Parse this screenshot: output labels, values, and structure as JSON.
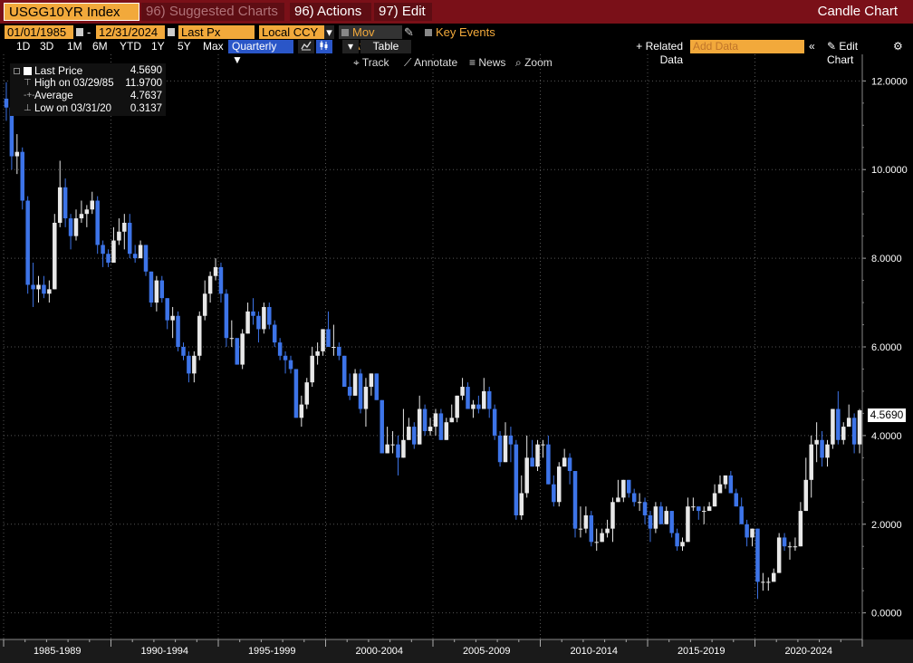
{
  "topbar": {
    "ticker": "USGG10YR Index",
    "suggested": "96) Suggested Charts ▾",
    "actions": "96) Actions ▾",
    "edit": "97) Edit ▾",
    "chart_type": "Candle Chart"
  },
  "controls": {
    "start_date": "01/01/1985",
    "end_date": "12/31/2024",
    "field": "Last Px",
    "currency": "Local CCY",
    "mov_avgs": "Mov Avgs",
    "key_events": "Key Events",
    "periods": [
      "1D",
      "3D",
      "1M",
      "6M",
      "YTD",
      "1Y",
      "5Y",
      "Max"
    ],
    "frequency": "Quarterly ▼",
    "table": "Table",
    "related_data": "+ Related Data",
    "add_data_placeholder": "Add Data",
    "edit_chart": "Edit Chart",
    "tools": {
      "track": "Track",
      "annotate": "Annotate",
      "news": "News",
      "zoom": "Zoom"
    }
  },
  "legend": {
    "last_label": "Last Price",
    "last_value": "4.5690",
    "high_label": "High on 03/29/85",
    "high_value": "11.9700",
    "avg_label": "Average",
    "avg_value": "4.7637",
    "low_label": "Low on 03/31/20",
    "low_value": "0.3137"
  },
  "last_price_tag": "4.5690",
  "colors": {
    "up": "#e8e8e8",
    "down": "#3d74e8",
    "grid": "#555555",
    "accent": "#f2a93b",
    "topbar": "#7a1018"
  },
  "chart_data": {
    "type": "candlestick",
    "frequency": "quarterly",
    "ylim": [
      -0.6,
      12.6
    ],
    "yticks": [
      "0.0000",
      "2.0000",
      "4.0000",
      "6.0000",
      "8.0000",
      "10.0000",
      "12.0000"
    ],
    "x_range": [
      1985.0,
      2025.0
    ],
    "x_categories": [
      "1985-1989",
      "1990-1994",
      "1995-1999",
      "2000-2004",
      "2005-2009",
      "2010-2014",
      "2015-2019",
      "2020-2024"
    ],
    "x_category_starts": [
      1985,
      1990,
      1995,
      2000,
      2005,
      2010,
      2015,
      2020
    ],
    "quarters": [
      {
        "t": "1985Q1",
        "o": 11.6,
        "h": 11.97,
        "l": 11.1,
        "c": 11.4
      },
      {
        "t": "1985Q2",
        "o": 11.4,
        "h": 11.5,
        "l": 10.0,
        "c": 10.3
      },
      {
        "t": "1985Q3",
        "o": 10.3,
        "h": 10.8,
        "l": 9.9,
        "c": 10.4
      },
      {
        "t": "1985Q4",
        "o": 10.4,
        "h": 10.5,
        "l": 9.1,
        "c": 9.3
      },
      {
        "t": "1986Q1",
        "o": 9.3,
        "h": 9.4,
        "l": 7.2,
        "c": 7.4
      },
      {
        "t": "1986Q2",
        "o": 7.4,
        "h": 7.9,
        "l": 6.9,
        "c": 7.3
      },
      {
        "t": "1986Q3",
        "o": 7.3,
        "h": 7.6,
        "l": 7.0,
        "c": 7.4
      },
      {
        "t": "1986Q4",
        "o": 7.4,
        "h": 7.6,
        "l": 7.1,
        "c": 7.2
      },
      {
        "t": "1987Q1",
        "o": 7.2,
        "h": 7.5,
        "l": 7.0,
        "c": 7.3
      },
      {
        "t": "1987Q2",
        "o": 7.3,
        "h": 9.0,
        "l": 7.3,
        "c": 8.8
      },
      {
        "t": "1987Q3",
        "o": 8.8,
        "h": 10.2,
        "l": 8.7,
        "c": 9.6
      },
      {
        "t": "1987Q4",
        "o": 9.6,
        "h": 9.8,
        "l": 8.7,
        "c": 8.9
      },
      {
        "t": "1988Q1",
        "o": 8.9,
        "h": 9.0,
        "l": 8.2,
        "c": 8.5
      },
      {
        "t": "1988Q2",
        "o": 8.5,
        "h": 9.1,
        "l": 8.4,
        "c": 8.9
      },
      {
        "t": "1988Q3",
        "o": 8.9,
        "h": 9.3,
        "l": 8.8,
        "c": 9.0
      },
      {
        "t": "1988Q4",
        "o": 9.0,
        "h": 9.2,
        "l": 8.7,
        "c": 9.1
      },
      {
        "t": "1989Q1",
        "o": 9.1,
        "h": 9.5,
        "l": 9.0,
        "c": 9.3
      },
      {
        "t": "1989Q2",
        "o": 9.3,
        "h": 9.4,
        "l": 8.1,
        "c": 8.3
      },
      {
        "t": "1989Q3",
        "o": 8.3,
        "h": 8.4,
        "l": 7.8,
        "c": 8.1
      },
      {
        "t": "1989Q4",
        "o": 8.1,
        "h": 8.2,
        "l": 7.8,
        "c": 7.9
      },
      {
        "t": "1990Q1",
        "o": 7.9,
        "h": 8.7,
        "l": 7.9,
        "c": 8.4
      },
      {
        "t": "1990Q2",
        "o": 8.4,
        "h": 8.9,
        "l": 8.3,
        "c": 8.6
      },
      {
        "t": "1990Q3",
        "o": 8.6,
        "h": 9.0,
        "l": 8.2,
        "c": 8.8
      },
      {
        "t": "1990Q4",
        "o": 8.8,
        "h": 9.0,
        "l": 8.0,
        "c": 8.1
      },
      {
        "t": "1991Q1",
        "o": 8.1,
        "h": 8.3,
        "l": 7.9,
        "c": 8.0
      },
      {
        "t": "1991Q2",
        "o": 8.0,
        "h": 8.4,
        "l": 8.0,
        "c": 8.3
      },
      {
        "t": "1991Q3",
        "o": 8.3,
        "h": 8.3,
        "l": 7.6,
        "c": 7.7
      },
      {
        "t": "1991Q4",
        "o": 7.7,
        "h": 7.7,
        "l": 6.9,
        "c": 7.0
      },
      {
        "t": "1992Q1",
        "o": 7.0,
        "h": 7.6,
        "l": 6.8,
        "c": 7.5
      },
      {
        "t": "1992Q2",
        "o": 7.5,
        "h": 7.6,
        "l": 7.0,
        "c": 7.1
      },
      {
        "t": "1992Q3",
        "o": 7.1,
        "h": 7.1,
        "l": 6.4,
        "c": 6.6
      },
      {
        "t": "1992Q4",
        "o": 6.6,
        "h": 6.9,
        "l": 6.2,
        "c": 6.7
      },
      {
        "t": "1993Q1",
        "o": 6.7,
        "h": 6.8,
        "l": 5.9,
        "c": 6.0
      },
      {
        "t": "1993Q2",
        "o": 6.0,
        "h": 6.1,
        "l": 5.7,
        "c": 5.8
      },
      {
        "t": "1993Q3",
        "o": 5.8,
        "h": 5.9,
        "l": 5.2,
        "c": 5.4
      },
      {
        "t": "1993Q4",
        "o": 5.4,
        "h": 5.9,
        "l": 5.2,
        "c": 5.8
      },
      {
        "t": "1994Q1",
        "o": 5.8,
        "h": 6.8,
        "l": 5.7,
        "c": 6.7
      },
      {
        "t": "1994Q2",
        "o": 6.7,
        "h": 7.5,
        "l": 6.6,
        "c": 7.2
      },
      {
        "t": "1994Q3",
        "o": 7.2,
        "h": 7.7,
        "l": 7.0,
        "c": 7.6
      },
      {
        "t": "1994Q4",
        "o": 7.6,
        "h": 8.0,
        "l": 7.5,
        "c": 7.8
      },
      {
        "t": "1995Q1",
        "o": 7.8,
        "h": 7.9,
        "l": 7.0,
        "c": 7.2
      },
      {
        "t": "1995Q2",
        "o": 7.2,
        "h": 7.3,
        "l": 6.0,
        "c": 6.2
      },
      {
        "t": "1995Q3",
        "o": 6.2,
        "h": 6.6,
        "l": 6.0,
        "c": 6.2
      },
      {
        "t": "1995Q4",
        "o": 6.2,
        "h": 6.2,
        "l": 5.6,
        "c": 5.6
      },
      {
        "t": "1996Q1",
        "o": 5.6,
        "h": 6.4,
        "l": 5.5,
        "c": 6.3
      },
      {
        "t": "1996Q2",
        "o": 6.3,
        "h": 7.0,
        "l": 6.3,
        "c": 6.8
      },
      {
        "t": "1996Q3",
        "o": 6.8,
        "h": 7.1,
        "l": 6.5,
        "c": 6.7
      },
      {
        "t": "1996Q4",
        "o": 6.7,
        "h": 6.8,
        "l": 6.1,
        "c": 6.4
      },
      {
        "t": "1997Q1",
        "o": 6.4,
        "h": 7.0,
        "l": 6.3,
        "c": 6.9
      },
      {
        "t": "1997Q2",
        "o": 6.9,
        "h": 7.0,
        "l": 6.4,
        "c": 6.5
      },
      {
        "t": "1997Q3",
        "o": 6.5,
        "h": 6.6,
        "l": 6.0,
        "c": 6.1
      },
      {
        "t": "1997Q4",
        "o": 6.1,
        "h": 6.2,
        "l": 5.7,
        "c": 5.8
      },
      {
        "t": "1998Q1",
        "o": 5.8,
        "h": 5.9,
        "l": 5.4,
        "c": 5.7
      },
      {
        "t": "1998Q2",
        "o": 5.7,
        "h": 5.8,
        "l": 5.4,
        "c": 5.5
      },
      {
        "t": "1998Q3",
        "o": 5.5,
        "h": 5.5,
        "l": 4.4,
        "c": 4.4
      },
      {
        "t": "1998Q4",
        "o": 4.4,
        "h": 4.9,
        "l": 4.2,
        "c": 4.7
      },
      {
        "t": "1999Q1",
        "o": 4.7,
        "h": 5.3,
        "l": 4.6,
        "c": 5.2
      },
      {
        "t": "1999Q2",
        "o": 5.2,
        "h": 6.0,
        "l": 5.1,
        "c": 5.8
      },
      {
        "t": "1999Q3",
        "o": 5.8,
        "h": 6.1,
        "l": 5.6,
        "c": 5.9
      },
      {
        "t": "1999Q4",
        "o": 5.9,
        "h": 6.4,
        "l": 5.8,
        "c": 6.4
      },
      {
        "t": "2000Q1",
        "o": 6.4,
        "h": 6.8,
        "l": 6.0,
        "c": 6.0
      },
      {
        "t": "2000Q2",
        "o": 6.0,
        "h": 6.5,
        "l": 5.8,
        "c": 6.0
      },
      {
        "t": "2000Q3",
        "o": 6.0,
        "h": 6.1,
        "l": 5.7,
        "c": 5.8
      },
      {
        "t": "2000Q4",
        "o": 5.8,
        "h": 5.8,
        "l": 5.1,
        "c": 5.1
      },
      {
        "t": "2001Q1",
        "o": 5.1,
        "h": 5.4,
        "l": 4.8,
        "c": 4.9
      },
      {
        "t": "2001Q2",
        "o": 4.9,
        "h": 5.5,
        "l": 4.9,
        "c": 5.4
      },
      {
        "t": "2001Q3",
        "o": 5.4,
        "h": 5.5,
        "l": 4.5,
        "c": 4.6
      },
      {
        "t": "2001Q4",
        "o": 4.6,
        "h": 5.3,
        "l": 4.2,
        "c": 5.1
      },
      {
        "t": "2002Q1",
        "o": 5.1,
        "h": 5.4,
        "l": 4.9,
        "c": 5.4
      },
      {
        "t": "2002Q2",
        "o": 5.4,
        "h": 5.4,
        "l": 4.8,
        "c": 4.8
      },
      {
        "t": "2002Q3",
        "o": 4.8,
        "h": 4.8,
        "l": 3.6,
        "c": 3.6
      },
      {
        "t": "2002Q4",
        "o": 3.6,
        "h": 4.2,
        "l": 3.6,
        "c": 3.8
      },
      {
        "t": "2003Q1",
        "o": 3.8,
        "h": 4.1,
        "l": 3.6,
        "c": 3.8
      },
      {
        "t": "2003Q2",
        "o": 3.8,
        "h": 4.0,
        "l": 3.1,
        "c": 3.5
      },
      {
        "t": "2003Q3",
        "o": 3.5,
        "h": 4.6,
        "l": 3.5,
        "c": 3.9
      },
      {
        "t": "2003Q4",
        "o": 3.9,
        "h": 4.4,
        "l": 3.9,
        "c": 4.2
      },
      {
        "t": "2004Q1",
        "o": 4.2,
        "h": 4.3,
        "l": 3.7,
        "c": 3.8
      },
      {
        "t": "2004Q2",
        "o": 3.8,
        "h": 4.9,
        "l": 3.8,
        "c": 4.6
      },
      {
        "t": "2004Q3",
        "o": 4.6,
        "h": 4.7,
        "l": 4.0,
        "c": 4.1
      },
      {
        "t": "2004Q4",
        "o": 4.1,
        "h": 4.4,
        "l": 4.0,
        "c": 4.2
      },
      {
        "t": "2005Q1",
        "o": 4.2,
        "h": 4.6,
        "l": 4.0,
        "c": 4.5
      },
      {
        "t": "2005Q2",
        "o": 4.5,
        "h": 4.6,
        "l": 3.9,
        "c": 3.9
      },
      {
        "t": "2005Q3",
        "o": 3.9,
        "h": 4.4,
        "l": 3.9,
        "c": 4.3
      },
      {
        "t": "2005Q4",
        "o": 4.3,
        "h": 4.7,
        "l": 4.3,
        "c": 4.4
      },
      {
        "t": "2006Q1",
        "o": 4.4,
        "h": 4.9,
        "l": 4.3,
        "c": 4.9
      },
      {
        "t": "2006Q2",
        "o": 4.9,
        "h": 5.3,
        "l": 4.8,
        "c": 5.1
      },
      {
        "t": "2006Q3",
        "o": 5.1,
        "h": 5.2,
        "l": 4.6,
        "c": 4.6
      },
      {
        "t": "2006Q4",
        "o": 4.6,
        "h": 4.8,
        "l": 4.4,
        "c": 4.7
      },
      {
        "t": "2007Q1",
        "o": 4.7,
        "h": 4.9,
        "l": 4.5,
        "c": 4.6
      },
      {
        "t": "2007Q2",
        "o": 4.6,
        "h": 5.3,
        "l": 4.6,
        "c": 5.0
      },
      {
        "t": "2007Q3",
        "o": 5.0,
        "h": 5.1,
        "l": 4.4,
        "c": 4.6
      },
      {
        "t": "2007Q4",
        "o": 4.6,
        "h": 4.7,
        "l": 3.9,
        "c": 4.0
      },
      {
        "t": "2008Q1",
        "o": 4.0,
        "h": 4.1,
        "l": 3.3,
        "c": 3.4
      },
      {
        "t": "2008Q2",
        "o": 3.4,
        "h": 4.3,
        "l": 3.4,
        "c": 4.0
      },
      {
        "t": "2008Q3",
        "o": 4.0,
        "h": 4.2,
        "l": 3.4,
        "c": 3.8
      },
      {
        "t": "2008Q4",
        "o": 3.8,
        "h": 3.9,
        "l": 2.1,
        "c": 2.2
      },
      {
        "t": "2009Q1",
        "o": 2.2,
        "h": 3.1,
        "l": 2.1,
        "c": 2.7
      },
      {
        "t": "2009Q2",
        "o": 2.7,
        "h": 4.0,
        "l": 2.6,
        "c": 3.5
      },
      {
        "t": "2009Q3",
        "o": 3.5,
        "h": 3.9,
        "l": 3.3,
        "c": 3.3
      },
      {
        "t": "2009Q4",
        "o": 3.3,
        "h": 3.9,
        "l": 3.2,
        "c": 3.8
      },
      {
        "t": "2010Q1",
        "o": 3.8,
        "h": 3.9,
        "l": 3.5,
        "c": 3.8
      },
      {
        "t": "2010Q2",
        "o": 3.8,
        "h": 4.0,
        "l": 2.9,
        "c": 2.9
      },
      {
        "t": "2010Q3",
        "o": 2.9,
        "h": 3.1,
        "l": 2.4,
        "c": 2.5
      },
      {
        "t": "2010Q4",
        "o": 2.5,
        "h": 3.4,
        "l": 2.4,
        "c": 3.3
      },
      {
        "t": "2011Q1",
        "o": 3.3,
        "h": 3.7,
        "l": 3.3,
        "c": 3.5
      },
      {
        "t": "2011Q2",
        "o": 3.5,
        "h": 3.6,
        "l": 2.9,
        "c": 3.2
      },
      {
        "t": "2011Q3",
        "o": 3.2,
        "h": 3.2,
        "l": 1.7,
        "c": 1.9
      },
      {
        "t": "2011Q4",
        "o": 1.9,
        "h": 2.4,
        "l": 1.7,
        "c": 1.9
      },
      {
        "t": "2012Q1",
        "o": 1.9,
        "h": 2.4,
        "l": 1.8,
        "c": 2.2
      },
      {
        "t": "2012Q2",
        "o": 2.2,
        "h": 2.3,
        "l": 1.5,
        "c": 1.6
      },
      {
        "t": "2012Q3",
        "o": 1.6,
        "h": 1.9,
        "l": 1.4,
        "c": 1.6
      },
      {
        "t": "2012Q4",
        "o": 1.6,
        "h": 1.9,
        "l": 1.6,
        "c": 1.8
      },
      {
        "t": "2013Q1",
        "o": 1.8,
        "h": 2.1,
        "l": 1.7,
        "c": 1.9
      },
      {
        "t": "2013Q2",
        "o": 1.9,
        "h": 2.6,
        "l": 1.6,
        "c": 2.5
      },
      {
        "t": "2013Q3",
        "o": 2.5,
        "h": 3.0,
        "l": 2.5,
        "c": 2.6
      },
      {
        "t": "2013Q4",
        "o": 2.6,
        "h": 3.0,
        "l": 2.5,
        "c": 3.0
      },
      {
        "t": "2014Q1",
        "o": 3.0,
        "h": 3.0,
        "l": 2.6,
        "c": 2.7
      },
      {
        "t": "2014Q2",
        "o": 2.7,
        "h": 2.8,
        "l": 2.4,
        "c": 2.5
      },
      {
        "t": "2014Q3",
        "o": 2.5,
        "h": 2.7,
        "l": 2.3,
        "c": 2.5
      },
      {
        "t": "2014Q4",
        "o": 2.5,
        "h": 2.6,
        "l": 2.0,
        "c": 2.2
      },
      {
        "t": "2015Q1",
        "o": 2.2,
        "h": 2.3,
        "l": 1.6,
        "c": 1.9
      },
      {
        "t": "2015Q2",
        "o": 1.9,
        "h": 2.5,
        "l": 1.8,
        "c": 2.4
      },
      {
        "t": "2015Q3",
        "o": 2.4,
        "h": 2.5,
        "l": 2.0,
        "c": 2.0
      },
      {
        "t": "2015Q4",
        "o": 2.0,
        "h": 2.4,
        "l": 2.0,
        "c": 2.3
      },
      {
        "t": "2016Q1",
        "o": 2.3,
        "h": 2.3,
        "l": 1.7,
        "c": 1.8
      },
      {
        "t": "2016Q2",
        "o": 1.8,
        "h": 1.9,
        "l": 1.4,
        "c": 1.5
      },
      {
        "t": "2016Q3",
        "o": 1.5,
        "h": 1.7,
        "l": 1.4,
        "c": 1.6
      },
      {
        "t": "2016Q4",
        "o": 1.6,
        "h": 2.6,
        "l": 1.6,
        "c": 2.4
      },
      {
        "t": "2017Q1",
        "o": 2.4,
        "h": 2.6,
        "l": 2.3,
        "c": 2.4
      },
      {
        "t": "2017Q2",
        "o": 2.4,
        "h": 2.4,
        "l": 2.1,
        "c": 2.3
      },
      {
        "t": "2017Q3",
        "o": 2.3,
        "h": 2.4,
        "l": 2.0,
        "c": 2.3
      },
      {
        "t": "2017Q4",
        "o": 2.3,
        "h": 2.5,
        "l": 2.3,
        "c": 2.4
      },
      {
        "t": "2018Q1",
        "o": 2.4,
        "h": 2.9,
        "l": 2.4,
        "c": 2.7
      },
      {
        "t": "2018Q2",
        "o": 2.7,
        "h": 3.1,
        "l": 2.7,
        "c": 2.9
      },
      {
        "t": "2018Q3",
        "o": 2.9,
        "h": 3.1,
        "l": 2.8,
        "c": 3.1
      },
      {
        "t": "2018Q4",
        "o": 3.1,
        "h": 3.2,
        "l": 2.7,
        "c": 2.7
      },
      {
        "t": "2019Q1",
        "o": 2.7,
        "h": 2.8,
        "l": 2.4,
        "c": 2.4
      },
      {
        "t": "2019Q2",
        "o": 2.4,
        "h": 2.6,
        "l": 2.0,
        "c": 2.0
      },
      {
        "t": "2019Q3",
        "o": 2.0,
        "h": 2.1,
        "l": 1.5,
        "c": 1.7
      },
      {
        "t": "2019Q4",
        "o": 1.7,
        "h": 1.9,
        "l": 1.5,
        "c": 1.9
      },
      {
        "t": "2020Q1",
        "o": 1.9,
        "h": 1.9,
        "l": 0.3137,
        "c": 0.7
      },
      {
        "t": "2020Q2",
        "o": 0.7,
        "h": 0.9,
        "l": 0.5,
        "c": 0.7
      },
      {
        "t": "2020Q3",
        "o": 0.7,
        "h": 0.8,
        "l": 0.5,
        "c": 0.7
      },
      {
        "t": "2020Q4",
        "o": 0.7,
        "h": 1.0,
        "l": 0.7,
        "c": 0.9
      },
      {
        "t": "2021Q1",
        "o": 0.9,
        "h": 1.8,
        "l": 0.9,
        "c": 1.7
      },
      {
        "t": "2021Q2",
        "o": 1.7,
        "h": 1.8,
        "l": 1.4,
        "c": 1.5
      },
      {
        "t": "2021Q3",
        "o": 1.5,
        "h": 1.6,
        "l": 1.2,
        "c": 1.5
      },
      {
        "t": "2021Q4",
        "o": 1.5,
        "h": 1.7,
        "l": 1.4,
        "c": 1.5
      },
      {
        "t": "2022Q1",
        "o": 1.5,
        "h": 2.5,
        "l": 1.5,
        "c": 2.3
      },
      {
        "t": "2022Q2",
        "o": 2.3,
        "h": 3.5,
        "l": 2.3,
        "c": 3.0
      },
      {
        "t": "2022Q3",
        "o": 3.0,
        "h": 4.0,
        "l": 2.6,
        "c": 3.8
      },
      {
        "t": "2022Q4",
        "o": 3.8,
        "h": 4.3,
        "l": 3.4,
        "c": 3.9
      },
      {
        "t": "2023Q1",
        "o": 3.9,
        "h": 4.1,
        "l": 3.3,
        "c": 3.5
      },
      {
        "t": "2023Q2",
        "o": 3.5,
        "h": 3.9,
        "l": 3.3,
        "c": 3.8
      },
      {
        "t": "2023Q3",
        "o": 3.8,
        "h": 4.6,
        "l": 3.7,
        "c": 4.6
      },
      {
        "t": "2023Q4",
        "o": 4.6,
        "h": 5.0,
        "l": 3.8,
        "c": 3.9
      },
      {
        "t": "2024Q1",
        "o": 3.9,
        "h": 4.3,
        "l": 3.8,
        "c": 4.2
      },
      {
        "t": "2024Q2",
        "o": 4.2,
        "h": 4.7,
        "l": 4.2,
        "c": 4.4
      },
      {
        "t": "2024Q3",
        "o": 4.4,
        "h": 4.5,
        "l": 3.6,
        "c": 3.8
      },
      {
        "t": "2024Q4",
        "o": 3.8,
        "h": 4.6,
        "l": 3.6,
        "c": 4.569
      }
    ]
  }
}
